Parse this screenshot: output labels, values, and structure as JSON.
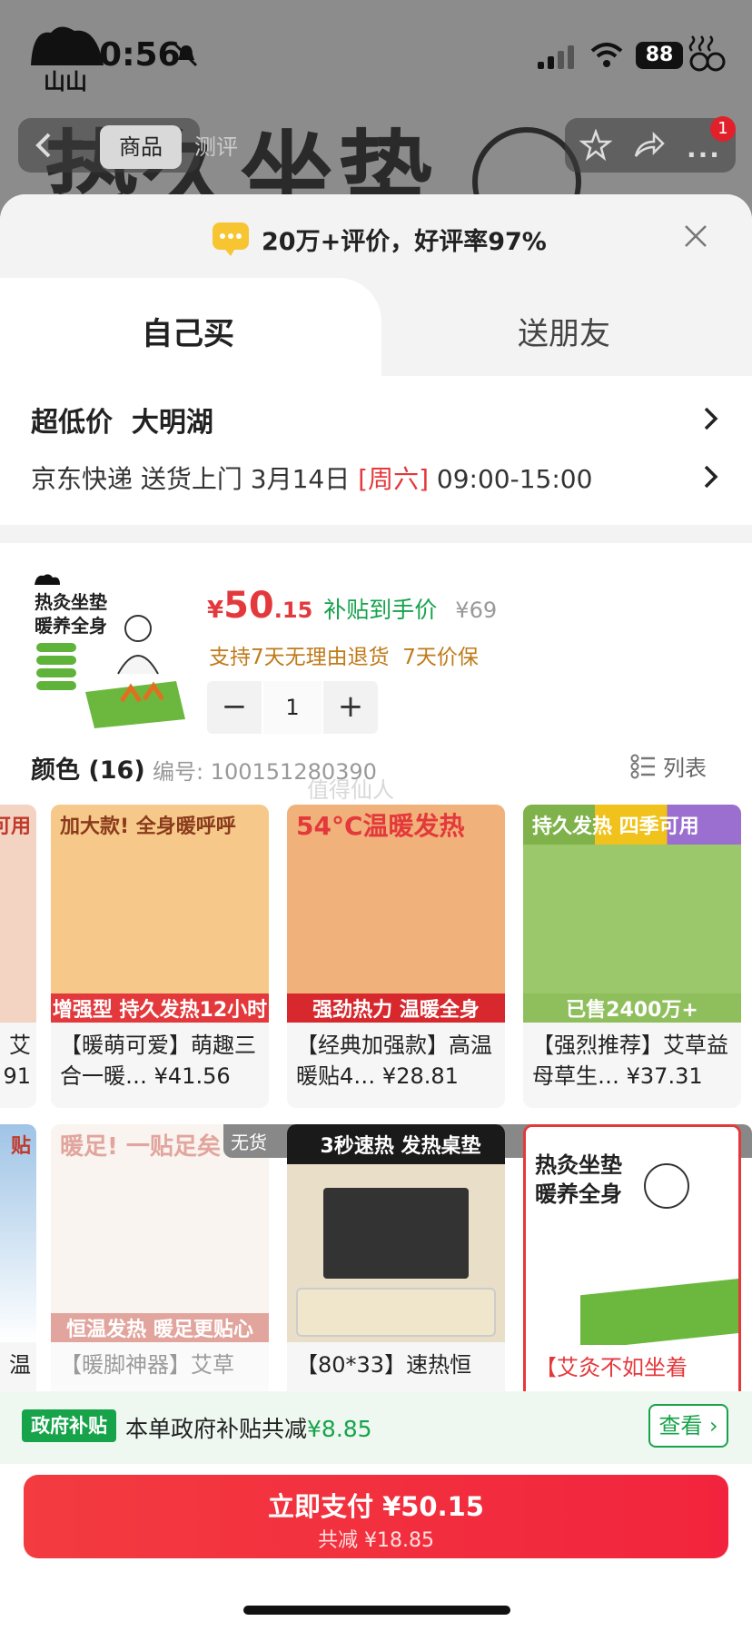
{
  "status": {
    "time": "20:56",
    "battery": "88"
  },
  "nav": {
    "tab_product": "商品",
    "tab_review": "测评",
    "badge": "1"
  },
  "background": {
    "title": "热久坐垫"
  },
  "sheet": {
    "review_text": "20万+评价，好评率97%",
    "tabs": {
      "buy": "自己买",
      "gift": "送朋友"
    },
    "price_info": "超低价  大明湖",
    "delivery": {
      "before": "京东快递 送货上门 3月14日 ",
      "day": "[周六]",
      "after": " 09:00-15:00"
    }
  },
  "product": {
    "price_symbol": "¥",
    "price_int": "50",
    "price_dec": ".15",
    "subsidy_label": "补贴到手价",
    "original_price": "¥69",
    "returns": "支持7天无理由退货  7天价保",
    "quantity": "1",
    "color_title": "颜色 (16)",
    "sku": "编号: 100151280390",
    "list_label": "列表",
    "watermark": "值得仙人"
  },
  "grid": [
    {
      "title": "【暖萌可爱】萌趣三合一暖…",
      "price": "¥41.56",
      "img_top": "加大款! 全身暖呼呼",
      "img_bottom": "增强型  持久发热12小时",
      "top_color": "#8a3b1d",
      "bg": "#f6c98a"
    },
    {
      "title": "【经典加强款】高温暖贴4…",
      "price": "¥28.81",
      "img_top": "54°C温暖发热",
      "img_bottom": "强劲热力 温暖全身",
      "top_color": "#e4393c",
      "bg": "#f0b27a"
    },
    {
      "title": "【强烈推荐】艾草益母草生…",
      "price": "¥37.31",
      "img_top": "持久发热 四季可用",
      "img_bottom": "已售2400万+",
      "top_color": "#ffffff",
      "bg": "#9bc86a"
    },
    {
      "title": "【暖脚神器】艾草",
      "price": "",
      "img_top": "暖足! 一贴足矣",
      "img_bottom": "恒温发热 暖足更贴心",
      "top_color": "#c0392b",
      "bg": "#f3e8dc",
      "badge": "无货"
    },
    {
      "title": "【80*33】速热恒",
      "price": "",
      "img_top": "3秒速热 发热桌垫",
      "img_bottom": "",
      "top_color": "#ffffff",
      "bg": "#e9dfc8"
    },
    {
      "title": "【艾灸不如坐着",
      "price": "",
      "img_top": "热灸坐垫 暖养全身",
      "img_bottom": "",
      "top_color": "#222222",
      "bg": "#ffffff"
    }
  ],
  "partial_left": {
    "row1_top": "可用",
    "row1_text1": "艾",
    "row1_text2": "91",
    "row2_top": "贴",
    "row2_text1": "温"
  },
  "thumb": {
    "line1": "热灸坐垫",
    "line2": "暖养全身"
  },
  "gov": {
    "badge": "政府补贴",
    "text_before": "本单政府补贴共减",
    "amount": "¥8.85",
    "button": "查看"
  },
  "pay": {
    "main": "立即支付 ¥50.15",
    "sub": "共减 ¥18.85"
  },
  "colors": {
    "accent_red": "#e4393c",
    "green": "#17a34a"
  }
}
